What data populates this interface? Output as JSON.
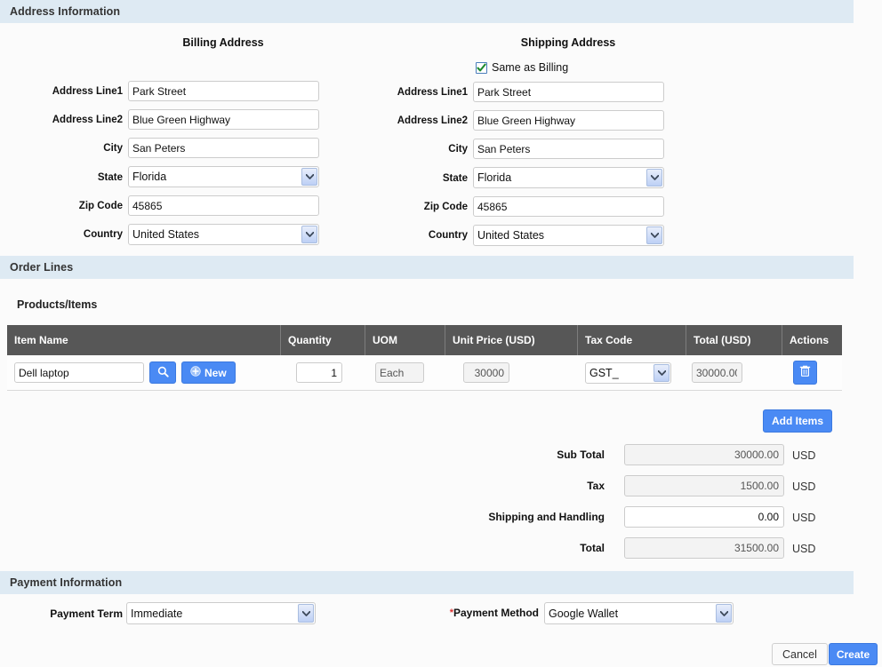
{
  "sections": {
    "address": "Address Information",
    "order_lines": "Order Lines",
    "payment": "Payment Information"
  },
  "billing": {
    "heading": "Billing Address",
    "labels": {
      "line1": "Address Line1",
      "line2": "Address Line2",
      "city": "City",
      "state": "State",
      "zip": "Zip Code",
      "country": "Country"
    },
    "values": {
      "line1": "Park Street",
      "line2": "Blue Green Highway",
      "city": "San Peters",
      "state": "Florida",
      "zip": "45865",
      "country": "United States"
    }
  },
  "shipping": {
    "heading": "Shipping Address",
    "same_as_billing_label": "Same as Billing",
    "same_as_billing_checked": true,
    "labels": {
      "line1": "Address Line1",
      "line2": "Address Line2",
      "city": "City",
      "state": "State",
      "zip": "Zip Code",
      "country": "Country"
    },
    "values": {
      "line1": "Park Street",
      "line2": "Blue Green Highway",
      "city": "San Peters",
      "state": "Florida",
      "zip": "45865",
      "country": "United States"
    }
  },
  "order_lines": {
    "products_heading": "Products/Items",
    "columns": [
      "Item Name",
      "Quantity",
      "UOM",
      "Unit Price (USD)",
      "Tax Code",
      "Total (USD)",
      "Actions"
    ],
    "row": {
      "item_name": "Dell laptop",
      "quantity": "1",
      "uom": "Each",
      "unit_price": "30000",
      "tax_code": "GST_",
      "total": "30000.00"
    },
    "search_icon": "search-icon",
    "new_button_label": "New",
    "delete_icon": "trash-icon",
    "add_items_label": "Add Items"
  },
  "totals": {
    "rows": [
      {
        "label": "Sub Total",
        "value": "30000.00",
        "currency": "USD",
        "readonly": true
      },
      {
        "label": "Tax",
        "value": "1500.00",
        "currency": "USD",
        "readonly": true
      },
      {
        "label": "Shipping and Handling",
        "value": "0.00",
        "currency": "USD",
        "readonly": false
      },
      {
        "label": "Total",
        "value": "31500.00",
        "currency": "USD",
        "readonly": true
      }
    ]
  },
  "payment": {
    "term_label": "Payment Term",
    "term_value": "Immediate",
    "method_label": "Payment Method",
    "method_required": "*",
    "method_value": "Google Wallet"
  },
  "footer": {
    "cancel_label": "Cancel",
    "create_label": "Create"
  },
  "colors": {
    "section_bar": "#deeaf3",
    "table_header": "#575757",
    "accent_blue": "#4a8af4",
    "check_green": "#1e8a2e",
    "required_red": "#d33333"
  }
}
